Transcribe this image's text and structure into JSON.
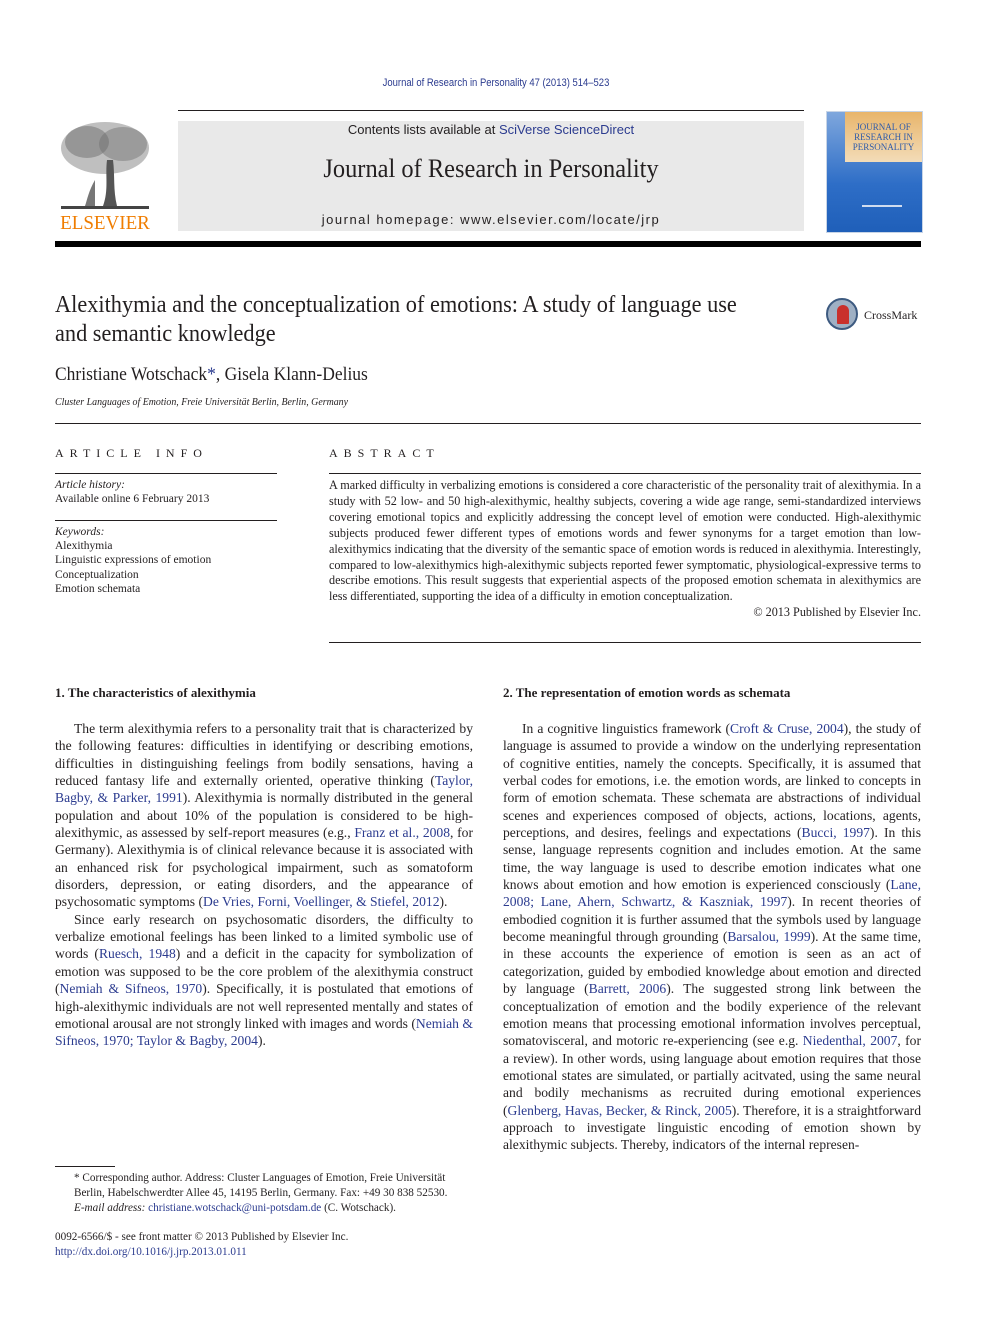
{
  "running_head": "Journal of Research in Personality 47 (2013) 514–523",
  "masthead": {
    "contents_prefix": "Contents lists available at ",
    "contents_link": "SciVerse ScienceDirect",
    "journal_title": "Journal of Research in Personality",
    "homepage": "journal homepage: www.elsevier.com/locate/jrp",
    "publisher_logo_text": "ELSEVIER",
    "cover_title": "JOURNAL OF RESEARCH IN PERSONALITY"
  },
  "colors": {
    "link": "#2b3b8f",
    "elsevier_orange": "#f07d00",
    "masthead_gray": "#e9e9e9",
    "cover_blue": "#2e6ec7"
  },
  "article": {
    "title": "Alexithymia and the conceptualization of emotions: A study of language use and semantic knowledge",
    "crossmark_label": "CrossMark",
    "author1": "Christiane Wotschack",
    "author1_mark": "*",
    "author_sep": ", ",
    "author2": "Gisela Klann-Delius",
    "affiliation": "Cluster Languages of Emotion, Freie Universität Berlin, Berlin, Germany"
  },
  "article_info": {
    "heading": "ARTICLE INFO",
    "history_label": "Article history:",
    "history_value": "Available online 6 February 2013",
    "keywords_label": "Keywords:",
    "keywords": [
      "Alexithymia",
      "Linguistic expressions of emotion",
      "Conceptualization",
      "Emotion schemata"
    ]
  },
  "abstract": {
    "heading": "ABSTRACT",
    "text": "A marked difficulty in verbalizing emotions is considered a core characteristic of the personality trait of alexithymia. In a study with 52 low- and 50 high-alexithymic, healthy subjects, covering a wide age range, semi-standardized interviews covering emotional topics and explicitly addressing the concept level of emotion were conducted. High-alexithymic subjects produced fewer different types of emotions words and fewer synonyms for a target emotion than low-alexithymics indicating that the diversity of the semantic space of emotion words is reduced in alexithymia. Interestingly, compared to low-alexithymics high-alexithymic subjects reported fewer symptomatic, physiological-expressive terms to describe emotions. This result suggests that experiential aspects of the proposed emotion schemata in alexithymics are less differentiated, supporting the idea of a difficulty in emotion conceptualization.",
    "copyright": "© 2013 Published by Elsevier Inc."
  },
  "section1": {
    "heading": "1. The characteristics of alexithymia",
    "p1": [
      {
        "t": "The term alexithymia refers to a personality trait that is characterized by the following features: difficulties in identifying or describing emotions, difficulties in distinguishing feelings from bodily sensations, having a reduced fantasy life and externally oriented, operative thinking ("
      },
      {
        "t": "Taylor, Bagby, & Parker, 1991",
        "link": true
      },
      {
        "t": "). Alexithymia is normally distributed in the general population and about 10% of the population is considered to be high-alexithymic, as assessed by self-report measures (e.g., "
      },
      {
        "t": "Franz et al., 2008",
        "link": true
      },
      {
        "t": ", for Germany). Alexithymia is of clinical relevance because it is associated with an enhanced risk for psychological impairment, such as somatoform disorders, depression, or eating disorders, and the appearance of psychosomatic symptoms ("
      },
      {
        "t": "De Vries, Forni, Voellinger, & Stiefel, 2012",
        "link": true
      },
      {
        "t": ")."
      }
    ],
    "p2": [
      {
        "t": "Since early research on psychosomatic disorders, the difficulty to verbalize emotional feelings has been linked to a limited symbolic use of words ("
      },
      {
        "t": "Ruesch, 1948",
        "link": true
      },
      {
        "t": ") and a deficit in the capacity for symbolization of emotion was supposed to be the core problem of the alexithymia construct ("
      },
      {
        "t": "Nemiah & Sifneos, 1970",
        "link": true
      },
      {
        "t": "). Specifically, it is postulated that emotions of high-alexithymic individuals are not well represented mentally and states of emotional arousal are not strongly linked with images and words ("
      },
      {
        "t": "Nemiah & Sifneos, 1970; Taylor & Bagby, 2004",
        "link": true
      },
      {
        "t": ")."
      }
    ]
  },
  "section2": {
    "heading": "2. The representation of emotion words as schemata",
    "p1": [
      {
        "t": "In a cognitive linguistics framework ("
      },
      {
        "t": "Croft & Cruse, 2004",
        "link": true
      },
      {
        "t": "), the study of language is assumed to provide a window on the underlying representation of cognitive entities, namely the concepts. Specifically, it is assumed that verbal codes for emotions, i.e. the emotion words, are linked to concepts in form of emotion schemata. These schemata are abstractions of individual scenes and experiences composed of objects, actions, locations, agents, perceptions, and desires, feelings and expectations ("
      },
      {
        "t": "Bucci, 1997",
        "link": true
      },
      {
        "t": "). In this sense, language represents cognition and includes emotion. At the same time, the way language is used to describe emotion indicates what one knows about emotion and how emotion is experienced consciously ("
      },
      {
        "t": "Lane, 2008; Lane, Ahern, Schwartz, & Kaszniak, 1997",
        "link": true
      },
      {
        "t": "). In recent theories of embodied cognition it is further assumed that the symbols used by language become meaningful through grounding ("
      },
      {
        "t": "Barsalou, 1999",
        "link": true
      },
      {
        "t": "). At the same time, in these accounts the experience of emotion is seen as an act of categorization, guided by embodied knowledge about emotion and directed by language ("
      },
      {
        "t": "Barrett, 2006",
        "link": true
      },
      {
        "t": "). The suggested strong link between the conceptualization of emotion and the bodily experience of the relevant emotion means that processing emotional information involves perceptual, somatovisceral, and motoric re-experiencing (see e.g. "
      },
      {
        "t": "Niedenthal, 2007",
        "link": true
      },
      {
        "t": ", for a review). In other words, using language about emotion requires that those emotional states are simulated, or partially acitvated, using the same neural and bodily mechanisms as recruited during emotional experiences ("
      },
      {
        "t": "Glenberg, Havas, Becker, & Rinck, 2005",
        "link": true
      },
      {
        "t": "). Therefore, it is a straightforward approach to investigate linguistic encoding of emotion shown by alexithymic subjects. Thereby, indicators of the internal represen-"
      }
    ]
  },
  "footnote": {
    "mark": "*",
    "text": " Corresponding author. Address: Cluster Languages of Emotion, Freie Universität Berlin, Habelschwerdter Allee 45, 14195 Berlin, Germany. Fax: +49 30 838 52530.",
    "email_label": "E-mail address: ",
    "email": "christiane.wotschack@uni-potsdam.de",
    "email_suffix": " (C. Wotschack)."
  },
  "front_matter": {
    "issn_line": "0092-6566/$ - see front matter © 2013 Published by Elsevier Inc.",
    "doi": "http://dx.doi.org/10.1016/j.jrp.2013.01.011"
  }
}
